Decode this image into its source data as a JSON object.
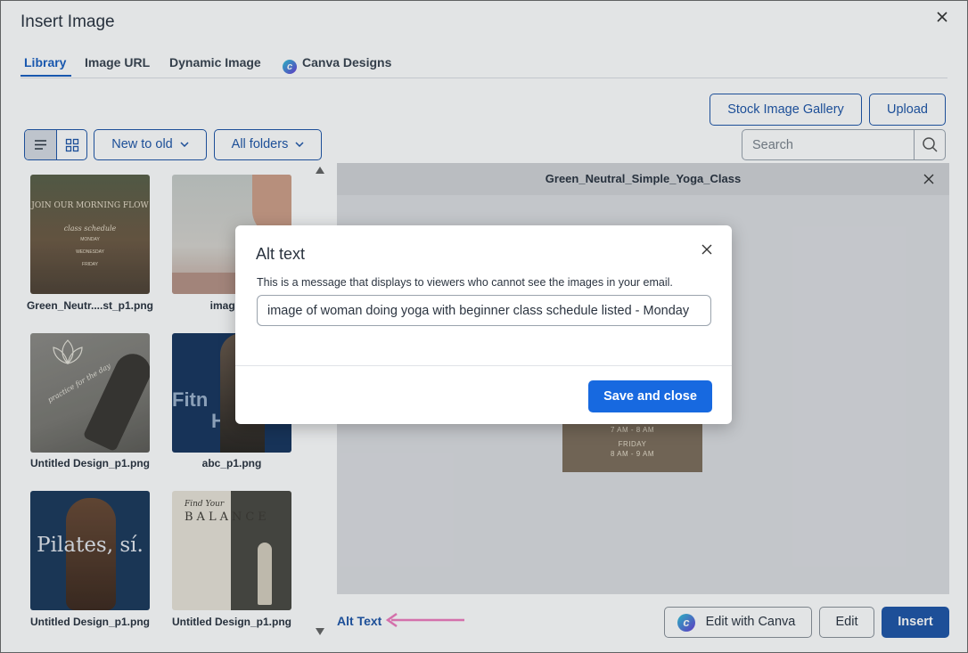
{
  "dialog": {
    "title": "Insert Image",
    "tabs": [
      {
        "label": "Library",
        "active": true
      },
      {
        "label": "Image URL",
        "active": false
      },
      {
        "label": "Dynamic Image",
        "active": false
      },
      {
        "label": "Canva Designs",
        "active": false
      }
    ]
  },
  "toolbar": {
    "stock_gallery_label": "Stock Image Gallery",
    "upload_label": "Upload",
    "sort_label": "New to old",
    "folder_label": "All folders",
    "search_placeholder": "Search"
  },
  "library": {
    "images": [
      {
        "caption": "Green_Neutr....st_p1.png",
        "title_text": "JOIN OUR MORNING FLOW",
        "sub_text": "class schedule",
        "days": [
          "MONDAY",
          "WEDNESDAY",
          "FRIDAY"
        ]
      },
      {
        "caption": "image_p"
      },
      {
        "caption": "Untitled Design_p1.png",
        "script_text": "practice for the day"
      },
      {
        "caption": "abc_p1.png",
        "big_text_1": "Fitn",
        "big_text_2": "Hu"
      },
      {
        "caption": "Untitled Design_p1.png",
        "big_text": "Pilates, sí."
      },
      {
        "caption": "Untitled Design_p1.png",
        "script_text": "Find Your",
        "big_text": "BALANCE"
      }
    ]
  },
  "preview": {
    "filename": "Green_Neutral_Simple_Yoga_Class",
    "image_lines": [
      "7 AM - 8 AM",
      "FRIDAY",
      "8 AM - 9 AM"
    ]
  },
  "modal": {
    "title": "Alt text",
    "description": "This is a message that displays to viewers who cannot see the images in your email.",
    "input_value": "image of woman doing yoga with beginner class schedule listed - Monday",
    "save_label": "Save and close"
  },
  "footer": {
    "alt_text_link": "Alt Text",
    "edit_canva_label": "Edit with Canva",
    "edit_label": "Edit",
    "insert_label": "Insert"
  },
  "colors": {
    "primary": "#1769e0",
    "link": "#1f56a8",
    "annotation_arrow": "#f07bbd"
  }
}
